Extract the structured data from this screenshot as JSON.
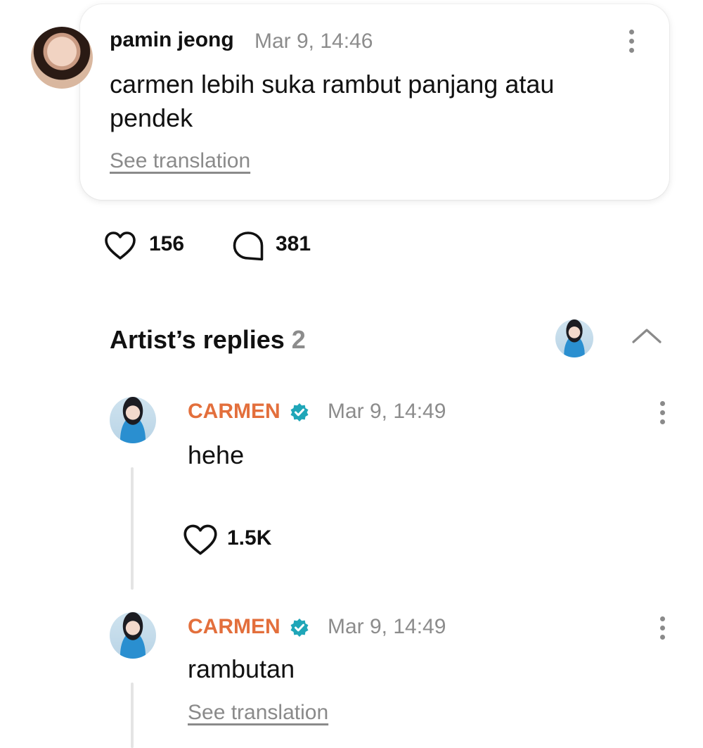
{
  "post": {
    "author": "pamin jeong",
    "time": "Mar 9, 14:46",
    "text": "carmen lebih suka rambut panjang atau pendek",
    "see_translation": "See translation",
    "likes": "156",
    "comments": "381"
  },
  "replies_section": {
    "title": "Artist’s replies",
    "count": "2"
  },
  "replies": [
    {
      "author": "CARMEN",
      "time": "Mar 9, 14:49",
      "text": "hehe",
      "likes": "1.5K"
    },
    {
      "author": "CARMEN",
      "time": "Mar 9, 14:49",
      "text": "rambutan",
      "see_translation": "See translation"
    }
  ],
  "colors": {
    "artist_name": "#e36f3c",
    "verified_badge": "#1fa6b8",
    "muted_text": "#8c8c8c"
  },
  "icons": {
    "like": "heart-outline-icon",
    "comment": "speech-bubble-icon",
    "more": "vertical-dots-icon",
    "collapse": "chevron-up-icon",
    "verified": "verified-badge-icon"
  }
}
